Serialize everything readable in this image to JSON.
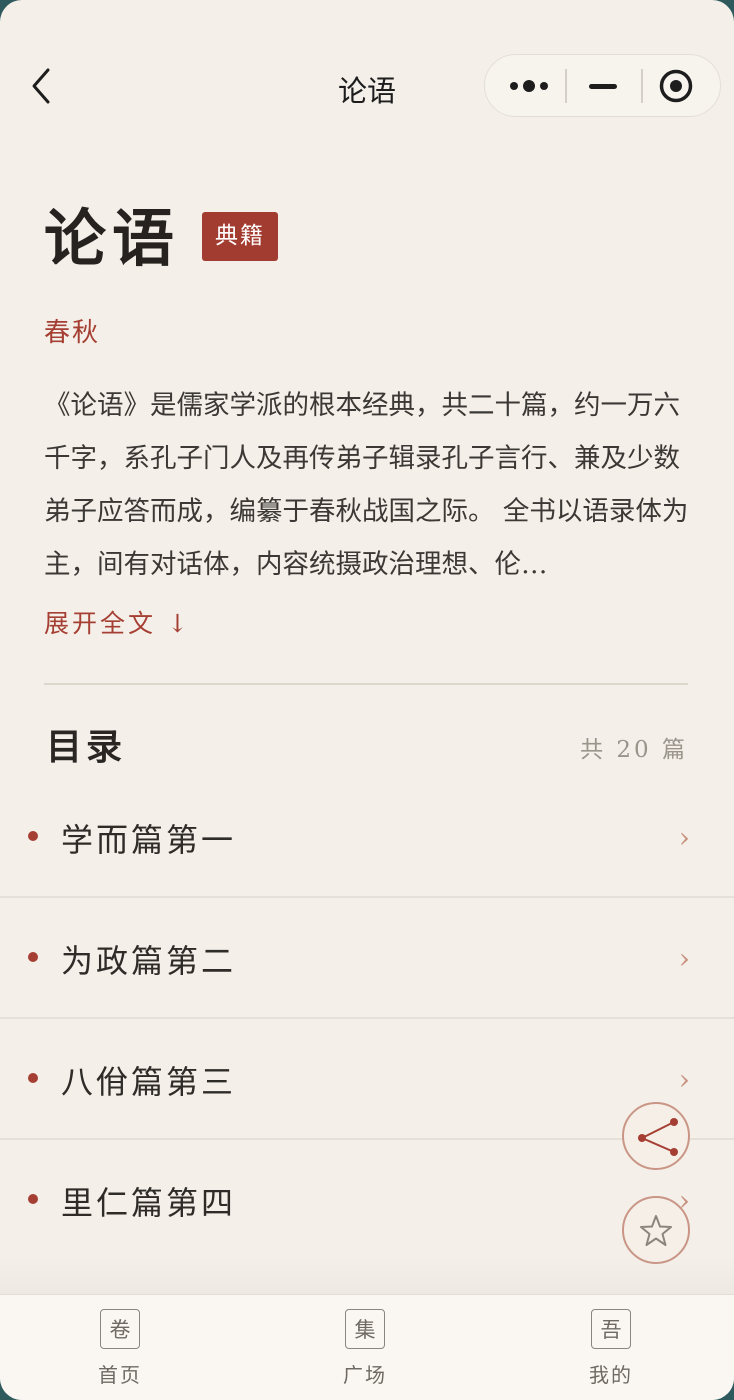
{
  "nav": {
    "title": "论语"
  },
  "header": {
    "title": "论语",
    "badge": "典籍",
    "dynasty": "春秋"
  },
  "intro": {
    "text": "《论语》是儒家学派的根本经典，共二十篇，约一万六千字，系孔子门人及再传弟子辑录孔子言行、兼及少数弟子应答而成，编纂于春秋战国之际。 全书以语录体为主，间有对话体，内容统摄政治理想、伦…",
    "expand_label": "展开全文 ↓"
  },
  "toc": {
    "title": "目录",
    "count": "共 20 篇",
    "items": [
      {
        "label": "学而篇第一"
      },
      {
        "label": "为政篇第二"
      },
      {
        "label": "八佾篇第三"
      },
      {
        "label": "里仁篇第四"
      }
    ]
  },
  "tabbar": {
    "items": [
      {
        "icon": "卷",
        "label": "首页"
      },
      {
        "icon": "集",
        "label": "广场"
      },
      {
        "icon": "吾",
        "label": "我的"
      }
    ]
  },
  "colors": {
    "accent": "#a63f33",
    "background": "#f4f0e9"
  }
}
